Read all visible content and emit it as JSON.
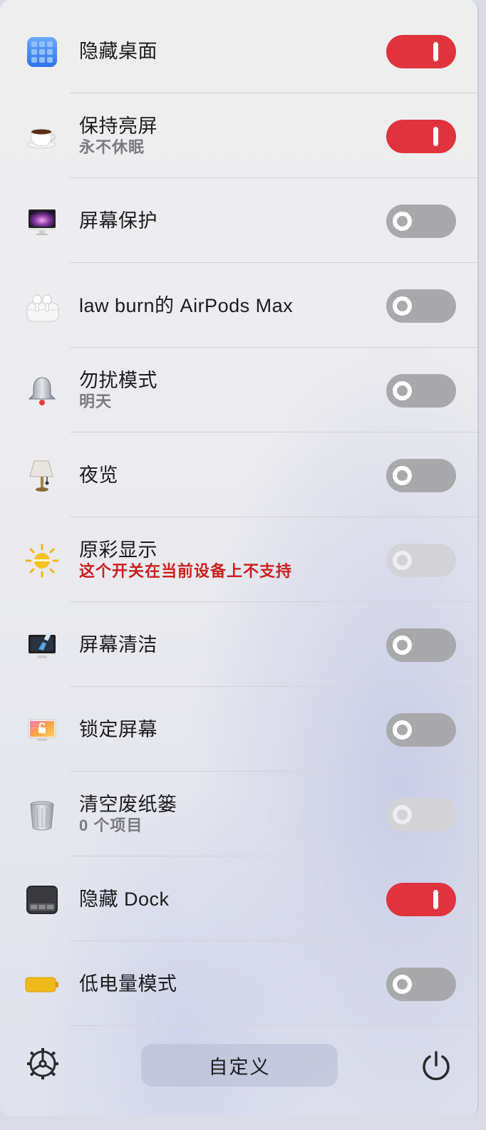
{
  "rows": [
    {
      "title": "隐藏桌面",
      "subtitle": "",
      "icon": "hide-desktop-icon",
      "toggle": "on"
    },
    {
      "title": "保持亮屏",
      "subtitle": "永不休眠",
      "icon": "coffee-cup-icon",
      "toggle": "on"
    },
    {
      "title": "屏幕保护",
      "subtitle": "",
      "icon": "imac-screensaver-icon",
      "toggle": "off"
    },
    {
      "title": "law burn的 AirPods Max",
      "subtitle": "",
      "icon": "airpods-icon",
      "toggle": "off"
    },
    {
      "title": "勿扰模式",
      "subtitle": "明天",
      "icon": "bell-icon",
      "toggle": "off"
    },
    {
      "title": "夜览",
      "subtitle": "",
      "icon": "lamp-icon",
      "toggle": "off"
    },
    {
      "title": "原彩显示",
      "subtitle": "这个开关在当前设备上不支持",
      "subtitle_warning": true,
      "icon": "sun-icon",
      "toggle": "disabled"
    },
    {
      "title": "屏幕清洁",
      "subtitle": "",
      "icon": "screen-clean-icon",
      "toggle": "off"
    },
    {
      "title": "锁定屏幕",
      "subtitle": "",
      "icon": "lock-screen-icon",
      "toggle": "off"
    },
    {
      "title": "清空废纸篓",
      "subtitle": "0 个项目",
      "icon": "trash-icon",
      "toggle": "disabled"
    },
    {
      "title": "隐藏 Dock",
      "subtitle": "",
      "icon": "dock-icon",
      "toggle": "on"
    },
    {
      "title": "低电量模式",
      "subtitle": "",
      "icon": "battery-icon",
      "toggle": "off"
    }
  ],
  "footer": {
    "customize_label": "自定义",
    "settings_icon": "gear-icon",
    "power_icon": "power-icon"
  },
  "colors": {
    "toggle_on": "#e0333d",
    "toggle_off": "#a9a9ab",
    "toggle_disabled": "#d3d3d6",
    "warning_text": "#cc1f1f"
  }
}
